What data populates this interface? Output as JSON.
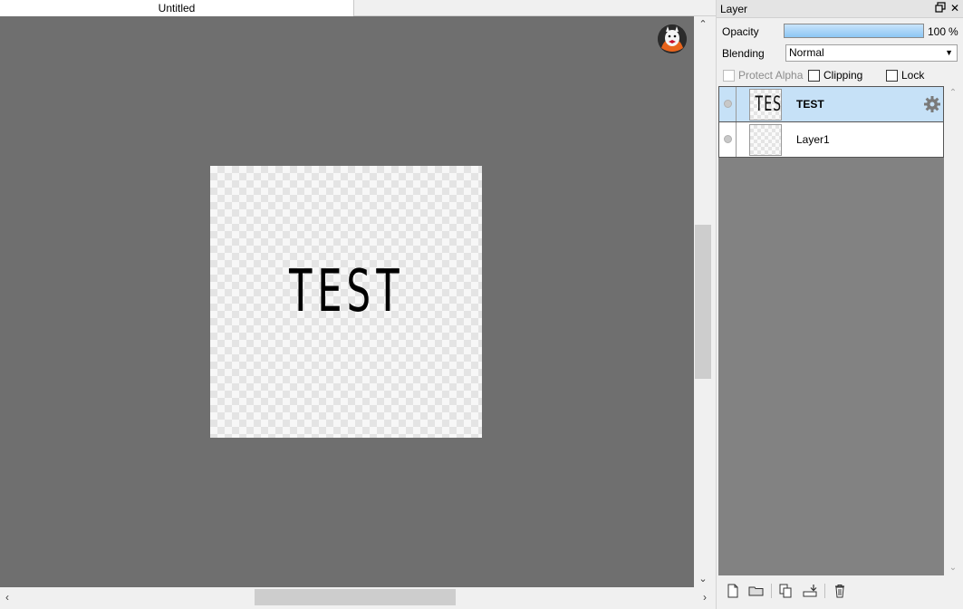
{
  "document": {
    "tab_title": "Untitled",
    "canvas_text": "TEST"
  },
  "layer_panel": {
    "title": "Layer",
    "opacity": {
      "label": "Opacity",
      "value": "100",
      "unit": "%",
      "fraction": 1.0
    },
    "blending": {
      "label": "Blending",
      "selected": "Normal"
    },
    "options": {
      "protect_alpha": {
        "label": "Protect Alpha",
        "checked": false,
        "enabled": false
      },
      "clipping": {
        "label": "Clipping",
        "checked": false,
        "enabled": true
      },
      "lock": {
        "label": "Lock",
        "checked": false,
        "enabled": true
      }
    },
    "layers": [
      {
        "name": "TEST",
        "thumbnail_text": "TEST",
        "selected": true,
        "has_settings_icon": true
      },
      {
        "name": "Layer1",
        "thumbnail_text": "",
        "selected": false,
        "has_settings_icon": false
      }
    ],
    "toolbar_icons": [
      "new-layer-icon",
      "new-folder-icon",
      "duplicate-layer-icon",
      "merge-down-icon",
      "delete-layer-icon"
    ]
  },
  "colors": {
    "canvas_background": "#6f6f6f",
    "selected_layer": "#c6e1f7",
    "opacity_fill": "#8cc6f4"
  }
}
